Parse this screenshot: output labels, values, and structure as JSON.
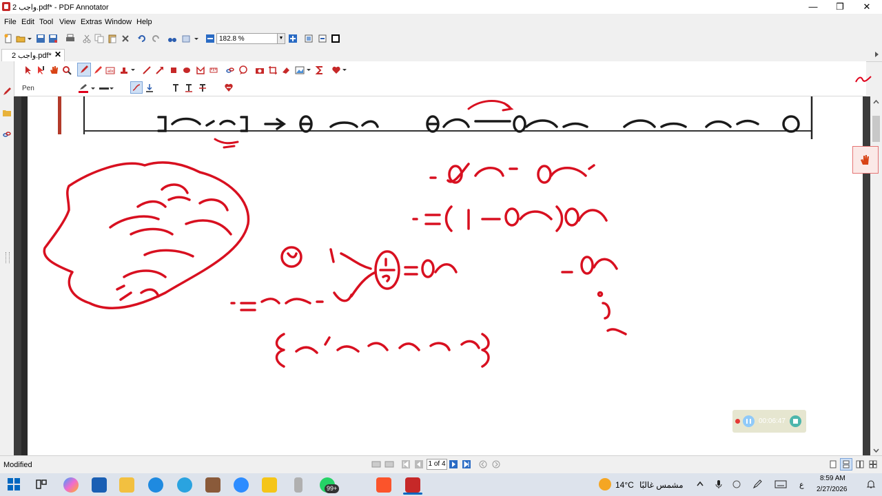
{
  "window": {
    "title": "واجب 2.pdf* - PDF Annotator",
    "controls": [
      "—",
      "❐",
      "✕"
    ]
  },
  "menu": [
    {
      "label": "File"
    },
    {
      "label": "Edit"
    },
    {
      "label": "Tool"
    },
    {
      "label": "View"
    },
    {
      "label": "Extras"
    },
    {
      "label": "Window"
    },
    {
      "label": "Help"
    }
  ],
  "toolbar": {
    "zoom_value": "182.8 %"
  },
  "tab": {
    "label": "واجب 2.pdf*",
    "close": "✕"
  },
  "annotation_toolbar": {
    "tool_name": "Pen",
    "pen_color": "#e0001b"
  },
  "document": {
    "printed_line": "[٣٦٠ ، ٠] ∋ θ حيث",
    "ink_color": "#d81020"
  },
  "recorder": {
    "time": "00:06:47"
  },
  "status": {
    "text": "Modified",
    "page_indicator": "1 of 4"
  },
  "taskbar": {
    "weather_temp": "14°C",
    "weather_desc": "مشمس غالبًا",
    "language": "ع",
    "time": "8:59 AM",
    "date": "2/27/2026",
    "whatsapp_badge": "99+"
  }
}
